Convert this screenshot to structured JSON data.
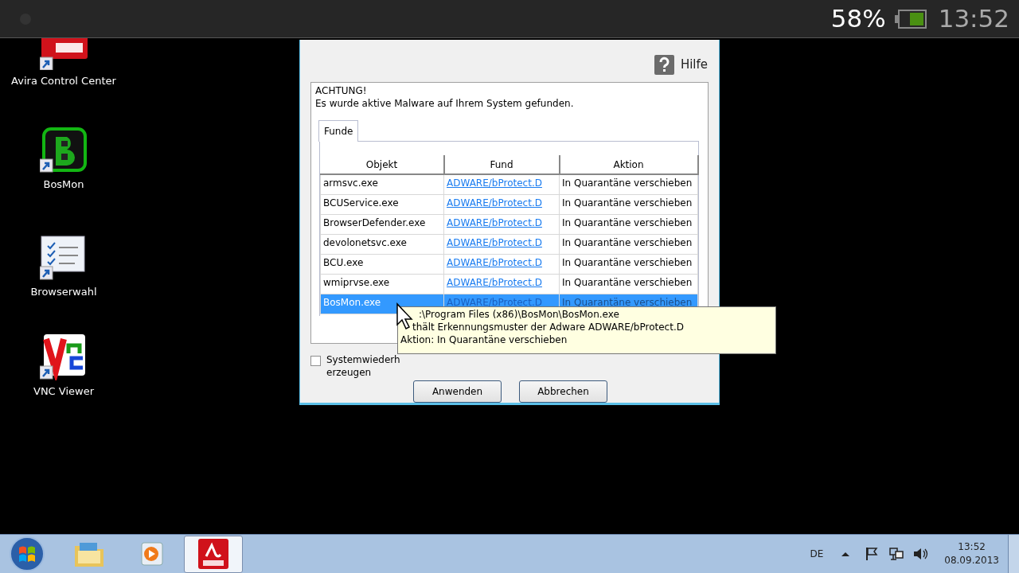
{
  "status_bar": {
    "battery": "58%",
    "time": "13:52"
  },
  "desktop_icons": [
    {
      "label": "Avira Control Center",
      "kind": "avira"
    },
    {
      "label": "BosMon",
      "kind": "bosmon"
    },
    {
      "label": "Browserwahl",
      "kind": "checklist"
    },
    {
      "label": "VNC Viewer",
      "kind": "vnc"
    }
  ],
  "dialog": {
    "help": "Hilfe",
    "heading": "ACHTUNG!",
    "message": "Es wurde aktive Malware auf Ihrem System gefunden.",
    "tabs": [
      {
        "label": "Funde",
        "selected": true
      }
    ],
    "table": {
      "columns": [
        "Objekt",
        "Fund",
        "Aktion"
      ],
      "rows": [
        {
          "object": "armsvc.exe",
          "detection": "ADWARE/bProtect.D",
          "action": "In Quarantäne verschieben",
          "selected": false
        },
        {
          "object": "BCUService.exe",
          "detection": "ADWARE/bProtect.D",
          "action": "In Quarantäne verschieben",
          "selected": false
        },
        {
          "object": "BrowserDefender.exe",
          "detection": "ADWARE/bProtect.D",
          "action": "In Quarantäne verschieben",
          "selected": false
        },
        {
          "object": "devolonetsvc.exe",
          "detection": "ADWARE/bProtect.D",
          "action": "In Quarantäne verschieben",
          "selected": false
        },
        {
          "object": "BCU.exe",
          "detection": "ADWARE/bProtect.D",
          "action": "In Quarantäne verschieben",
          "selected": false
        },
        {
          "object": "wmiprvse.exe",
          "detection": "ADWARE/bProtect.D",
          "action": "In Quarantäne verschieben",
          "selected": false
        },
        {
          "object": "BosMon.exe",
          "detection": "ADWARE/bProtect.D",
          "action": "In Quarantäne verschieben",
          "selected": true
        }
      ]
    },
    "checkbox": {
      "label_lines": [
        "Systemwiederh",
        "erzeugen"
      ],
      "checked": false
    },
    "buttons": [
      "Anwenden",
      "Abbrechen"
    ]
  },
  "tooltip": {
    "lines": [
      ":\\Program Files (x86)\\BosMon\\BosMon.exe",
      "thält Erkennungsmuster der Adware ADWARE/bProtect.D",
      "Aktion: In Quarantäne verschieben"
    ]
  },
  "taskbar": {
    "apps": [
      {
        "kind": "explorer",
        "active": false
      },
      {
        "kind": "media",
        "active": false
      },
      {
        "kind": "avira",
        "active": true
      }
    ],
    "language": "DE",
    "time": "13:52",
    "date": "08.09.2013"
  }
}
